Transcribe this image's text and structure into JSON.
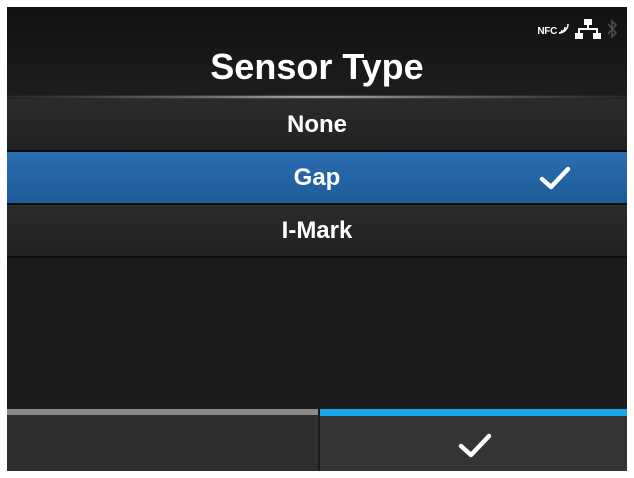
{
  "status": {
    "nfc_label": "NFC",
    "icons": [
      "nfc-icon",
      "network-icon",
      "bluetooth-icon"
    ]
  },
  "header": {
    "title": "Sensor Type"
  },
  "options": [
    {
      "label": "None",
      "selected": false
    },
    {
      "label": "Gap",
      "selected": true
    },
    {
      "label": "I-Mark",
      "selected": false
    }
  ],
  "footer": {
    "left_action": "back",
    "right_action": "confirm-icon"
  },
  "colors": {
    "selected_row": "#1f5b99",
    "confirm_bar": "#17a8e8",
    "back_bar": "#8a8a8a",
    "background": "#1b1b1b"
  }
}
